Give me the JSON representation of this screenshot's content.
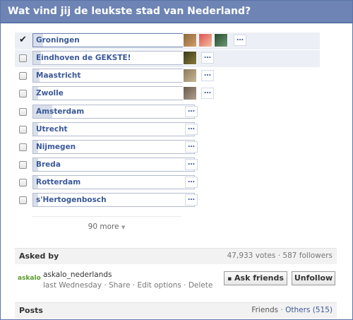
{
  "dialog": {
    "title": "Wat vind jij de leukste stad van Nederland?"
  },
  "options": [
    {
      "label": "Groningen",
      "checked": true,
      "fill_pct": 6
    },
    {
      "label": "Eindhoven de GEKSTE!",
      "checked": false,
      "fill_pct": 5
    },
    {
      "label": "Maastricht",
      "checked": false,
      "fill_pct": 4
    },
    {
      "label": "Zwolle",
      "checked": false,
      "fill_pct": 3
    },
    {
      "label": "Amsterdam",
      "checked": false,
      "fill_pct": 12
    },
    {
      "label": "Utrecht",
      "checked": false,
      "fill_pct": 3
    },
    {
      "label": "Nijmegen",
      "checked": false,
      "fill_pct": 3
    },
    {
      "label": "Breda",
      "checked": false,
      "fill_pct": 3
    },
    {
      "label": "Rotterdam",
      "checked": false,
      "fill_pct": 3
    },
    {
      "label": "s'Hertogenbosch",
      "checked": false,
      "fill_pct": 3
    }
  ],
  "more": {
    "label": "90 more",
    "icon": "chevron-down-icon"
  },
  "asked_by": {
    "title": "Asked by",
    "stats": "47,933 votes · 587 followers",
    "logo_text": "askalo",
    "name": "askalo_nederlands",
    "when": "last Wednesday",
    "sep": "·",
    "share": "Share",
    "edit": "Edit options",
    "delete": "Delete",
    "ask_friends": "Ask friends",
    "unfollow": "Unfollow"
  },
  "posts": {
    "title": "Posts",
    "friends": "Friends",
    "sep": "·",
    "others": "Others (515)"
  }
}
